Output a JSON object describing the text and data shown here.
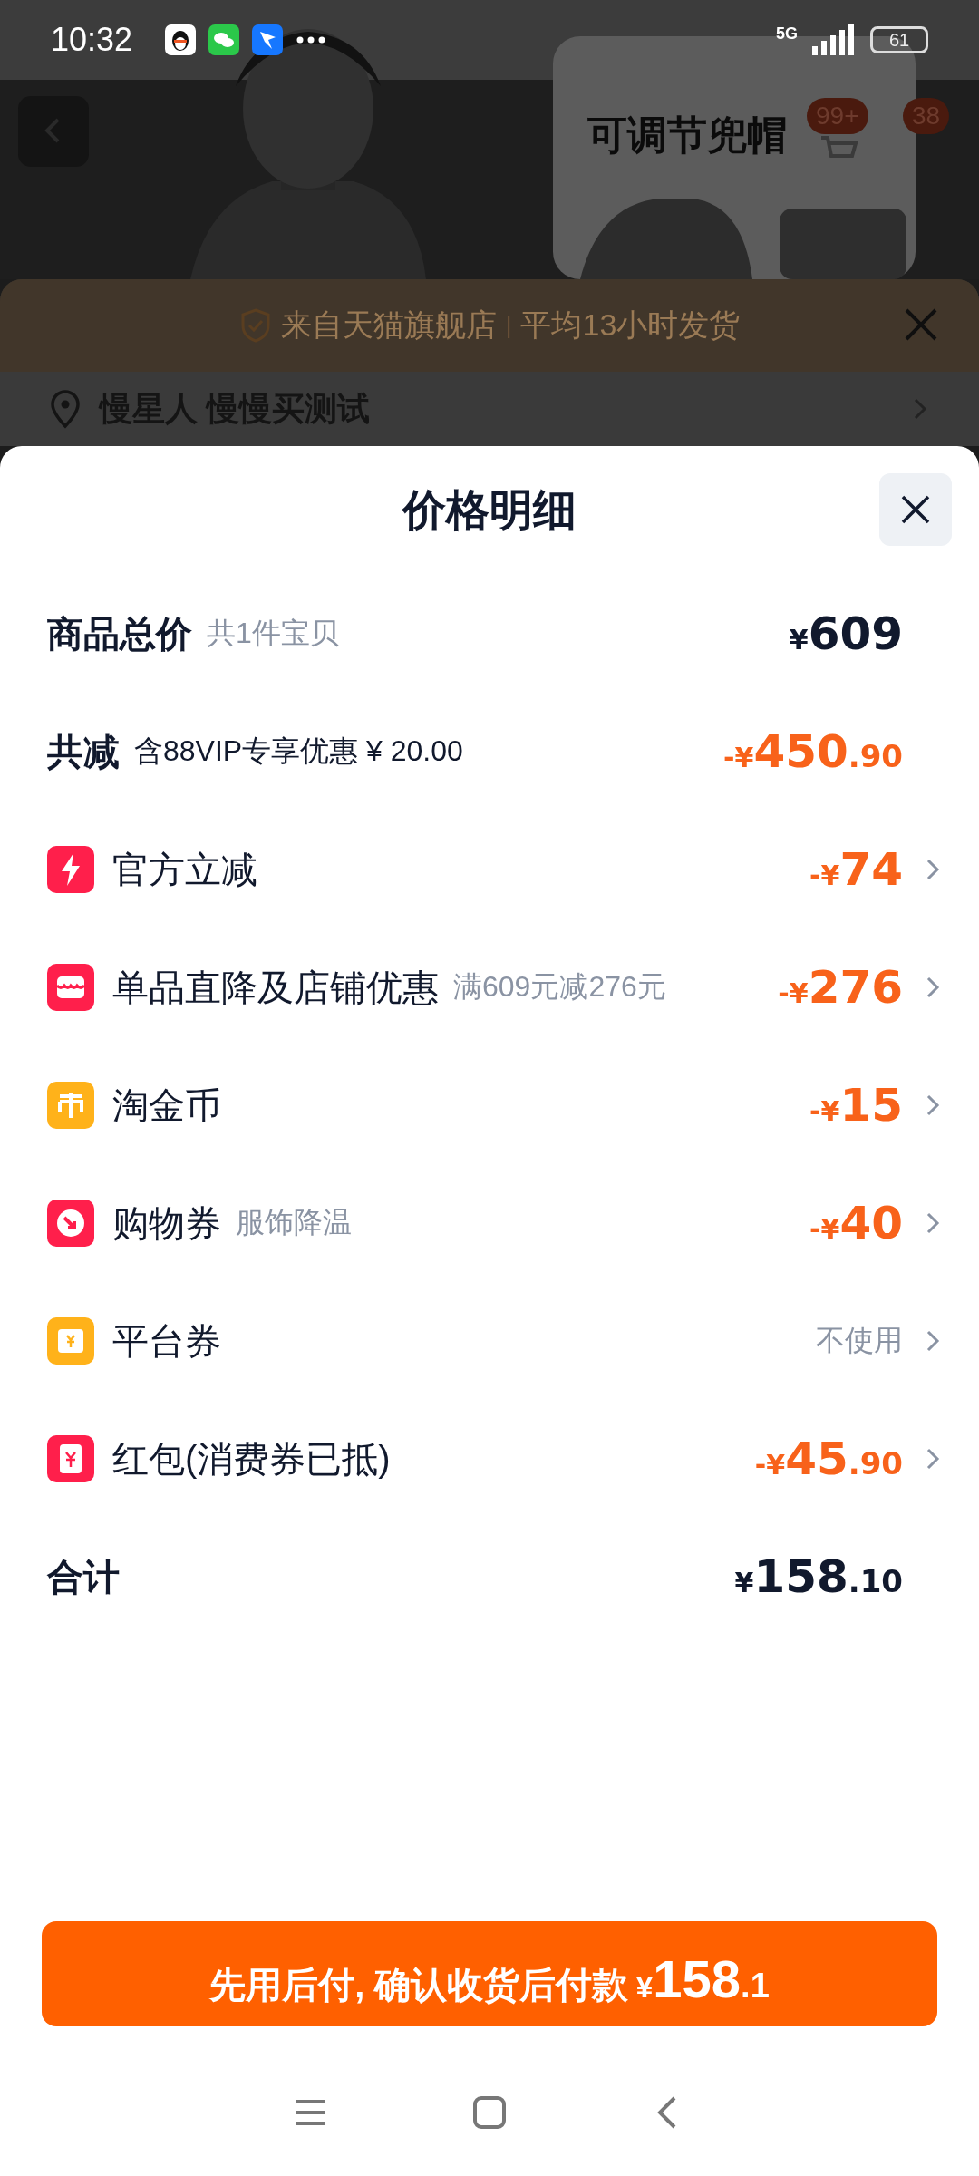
{
  "status_bar": {
    "time": "10:32",
    "network": "5G",
    "battery": "61"
  },
  "product_header": {
    "title": "可调节兜帽",
    "badges": [
      "99+",
      "38"
    ]
  },
  "store_banner": {
    "text": "来自天猫旗舰店",
    "divider": "|",
    "note": "平均13小时发货"
  },
  "address": {
    "text": "慢星人 慢慢买测试"
  },
  "price_sheet": {
    "title": "价格明细",
    "rows": [
      {
        "kind": "total",
        "label": "商品总价",
        "note": "共1件宝贝",
        "amount": {
          "prefix": "¥",
          "main": "609"
        }
      },
      {
        "kind": "saving",
        "label": "共减",
        "note": "含88VIP专享优惠 ¥ 20.00",
        "amount": {
          "prefix": "-¥",
          "main": "450",
          "cents": ".90"
        }
      },
      {
        "kind": "discount",
        "color": "#ff1f4b",
        "label": "官方立减",
        "amount": {
          "prefix": "-¥",
          "main": "74"
        }
      },
      {
        "kind": "discount",
        "color": "#ff1f4b",
        "label": "单品直降及店铺优惠",
        "note": "满609元减276元",
        "amount": {
          "prefix": "-¥",
          "main": "276"
        }
      },
      {
        "kind": "discount",
        "color": "#ffb21a",
        "label": "淘金币",
        "amount": {
          "prefix": "-¥",
          "main": "15"
        }
      },
      {
        "kind": "discount",
        "color": "#ff1f4b",
        "label": "购物券",
        "note": "服饰降温",
        "amount": {
          "prefix": "-¥",
          "main": "40"
        }
      },
      {
        "kind": "discount",
        "color": "#ffb21a",
        "label": "平台券",
        "status": "不使用"
      },
      {
        "kind": "discount",
        "color": "#ff1f4b",
        "label": "红包(消费券已抵)",
        "amount": {
          "prefix": "-¥",
          "main": "45",
          "cents": ".90"
        }
      },
      {
        "kind": "total",
        "label": "合计",
        "amount": {
          "prefix": "¥",
          "main": "158",
          "cents": ".10"
        }
      }
    ],
    "pay_button": {
      "label": "先用后付, 确认收货后付款",
      "prefix": "¥",
      "main": "158",
      "cents": ".1"
    }
  }
}
